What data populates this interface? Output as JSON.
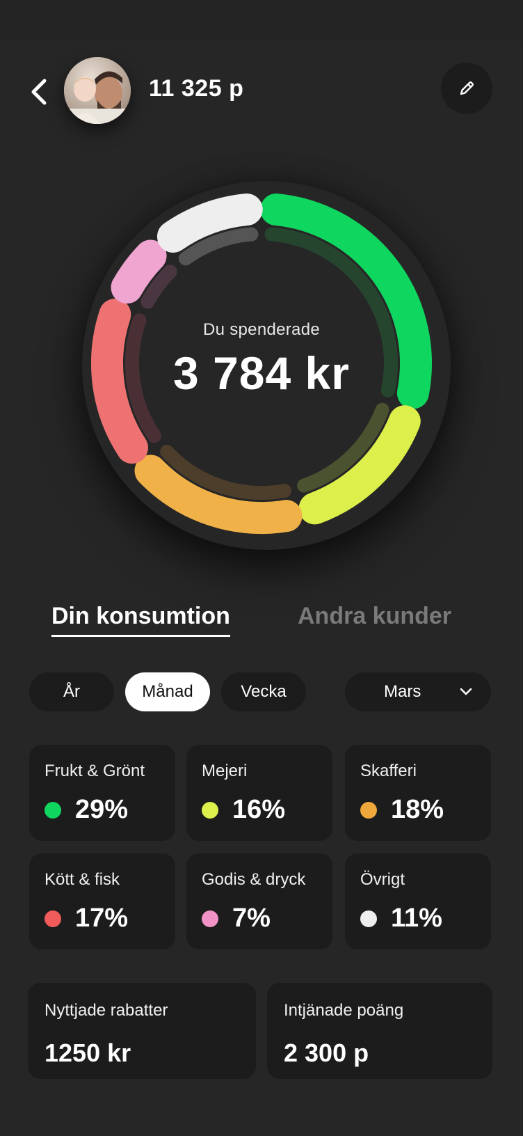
{
  "header": {
    "points": "11 325 p",
    "back_icon": "chevron-left-icon",
    "edit_icon": "pencil-icon",
    "avatar": "user-avatar"
  },
  "donut": {
    "caption": "Du spenderade",
    "total": "3 784 kr"
  },
  "tabs": [
    {
      "label": "Din konsumtion",
      "active": true
    },
    {
      "label": "Andra kunder",
      "active": false
    }
  ],
  "periods": [
    {
      "label": "År",
      "active": false
    },
    {
      "label": "Månad",
      "active": true
    },
    {
      "label": "Vecka",
      "active": false
    }
  ],
  "month_select": {
    "value": "Mars",
    "icon": "chevron-down-icon"
  },
  "categories": [
    {
      "label": "Frukt & Grönt",
      "percent": "29%",
      "color": "#0fd65f"
    },
    {
      "label": "Mejeri",
      "percent": "16%",
      "color": "#dcef4a"
    },
    {
      "label": "Skafferi",
      "percent": "18%",
      "color": "#f0a83c"
    },
    {
      "label": "Kött & fisk",
      "percent": "17%",
      "color": "#ef5b5b"
    },
    {
      "label": "Godis & dryck",
      "percent": "7%",
      "color": "#f092c6"
    },
    {
      "label": "Övrigt",
      "percent": "11%",
      "color": "#eeeeee"
    }
  ],
  "summary": {
    "discounts_label": "Nyttjade rabatter",
    "discounts_value": "1250 kr",
    "earned_label": "Intjänade poäng",
    "earned_value": "2 300 p"
  },
  "chart_data": {
    "type": "pie",
    "categories": [
      "Frukt & Grönt",
      "Mejeri",
      "Skafferi",
      "Kött & fisk",
      "Godis & dryck",
      "Övrigt"
    ],
    "values": [
      29,
      16,
      18,
      17,
      7,
      11
    ],
    "colors": [
      "#0fd65f",
      "#dcef4a",
      "#f0b248",
      "#ee7272",
      "#f0a4d0",
      "#eeeeee"
    ],
    "inner_values": [
      26,
      9,
      18,
      9,
      6,
      8
    ],
    "inner_colors": [
      "#26452e",
      "#4a5230",
      "#4d3e2b",
      "#4a3035",
      "#4a3641",
      "#555555"
    ]
  }
}
